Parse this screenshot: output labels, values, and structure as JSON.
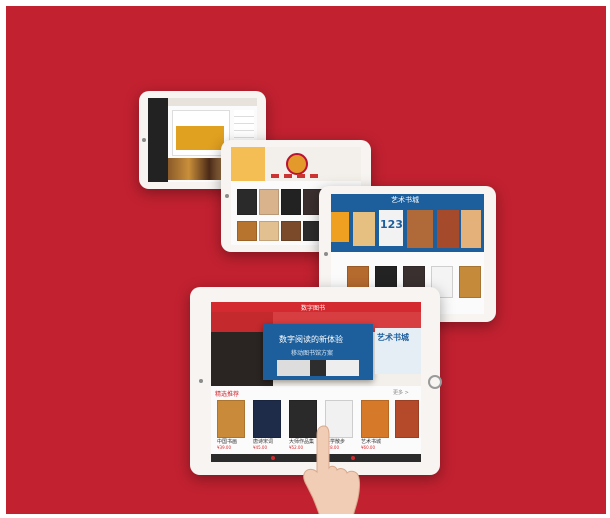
{
  "background_color": "#c22130",
  "accent_red": "#d42a2f",
  "banner_blue": "#1d5f9c",
  "tablet4": {
    "topbar_title": "数字图书",
    "banner_headline": "数字阅读的新体验",
    "banner_sub": "移动图书馆方案",
    "banner_side_title": "艺术书城",
    "section_title": "精选推荐",
    "section_more": "更多 >",
    "book_titles": [
      "中国书画",
      "唐诗宋词",
      "大师作品集",
      "美学散步",
      "艺术书城"
    ],
    "book_prices": [
      "¥39.00",
      "¥45.00",
      "¥52.00",
      "¥28.00",
      "¥60.00"
    ]
  },
  "tablet3": {
    "header_title": "艺术书城",
    "banner_number": "123"
  },
  "icons": [
    "camera-icon",
    "home-button-icon",
    "hand-icon"
  ]
}
